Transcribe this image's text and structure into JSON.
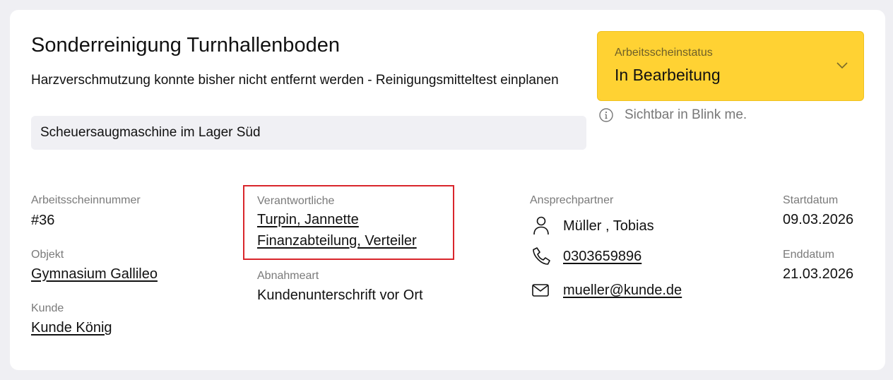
{
  "header": {
    "title": "Sonderreinigung Turnhallenboden",
    "description": "Harzverschmutzung konnte bisher nicht entfernt werden - Reinigungsmitteltest einplanen",
    "location": "Scheuersaugmaschine im Lager Süd"
  },
  "status": {
    "label": "Arbeitsscheinstatus",
    "value": "In Bearbeitung",
    "color": "#ffd233",
    "note": "Sichtbar in Blink me.",
    "icons": {
      "dropdown": "chevron-down-icon",
      "note": "info-icon"
    }
  },
  "details": {
    "number_label": "Arbeitsscheinnummer",
    "number_value": "#36",
    "object_label": "Objekt",
    "object_value": "Gymnasium Gallileo",
    "customer_label": "Kunde",
    "customer_value": "Kunde König",
    "responsible_label": "Verantwortliche",
    "responsible_person": "Turpin, Jannette",
    "responsible_group": "Finanzabteilung, Verteiler",
    "acceptance_label": "Abnahmeart",
    "acceptance_value": "Kundenunterschrift vor Ort",
    "contact_label": "Ansprechpartner",
    "contact_name": "Müller , Tobias",
    "contact_phone": "0303659896",
    "contact_email": "mueller@kunde.de",
    "start_label": "Startdatum",
    "start_value": "09.03.2026",
    "end_label": "Enddatum",
    "end_value": "21.03.2026"
  },
  "highlight_color": "#d9262c"
}
